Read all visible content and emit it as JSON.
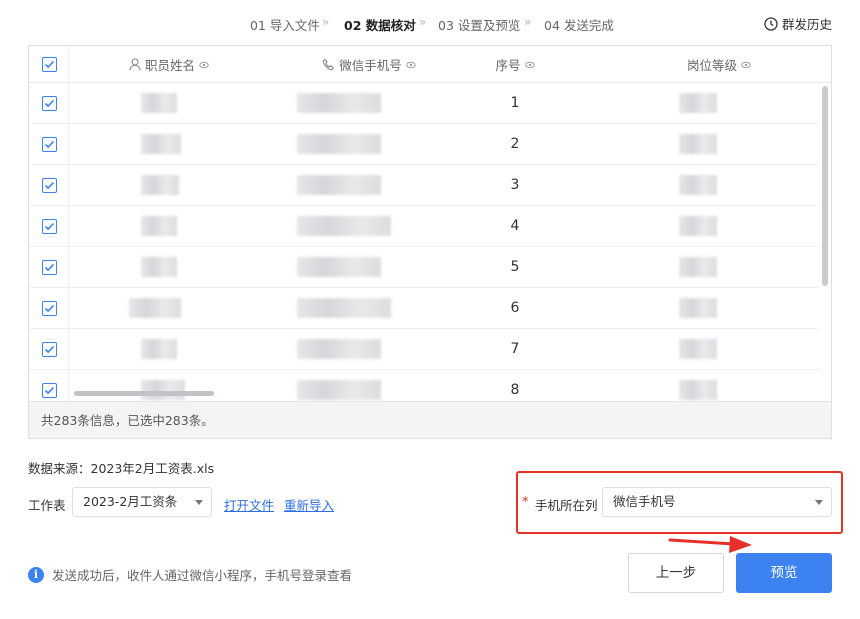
{
  "steps": [
    {
      "label": "01 导入文件",
      "active": false
    },
    {
      "label": "02 数据核对",
      "active": true
    },
    {
      "label": "03 设置及预览",
      "active": false
    },
    {
      "label": "04 发送完成",
      "active": false
    }
  ],
  "step_separator": "»",
  "history_label": "群发历史",
  "table": {
    "columns": [
      {
        "label": "职员姓名",
        "icon": "user-icon"
      },
      {
        "label": "微信手机号",
        "icon": "phone-icon"
      },
      {
        "label": "序号",
        "icon": null
      },
      {
        "label": "岗位等级",
        "icon": null
      }
    ],
    "rows": [
      {
        "seq": "1"
      },
      {
        "seq": "2"
      },
      {
        "seq": "3"
      },
      {
        "seq": "4"
      },
      {
        "seq": "5"
      },
      {
        "seq": "6"
      },
      {
        "seq": "7"
      },
      {
        "seq": "8"
      }
    ],
    "footer": "共283条信息，已选中283条。"
  },
  "source_text": "数据来源：2023年2月工资表.xls",
  "worksheet": {
    "label": "工作表",
    "value": "2023-2月工资条"
  },
  "links": {
    "open_file": "打开文件",
    "reimport": "重新导入"
  },
  "phone_column": {
    "required_mark": "*",
    "label": "手机所在列",
    "value": "微信手机号"
  },
  "info_text": "发送成功后，收件人通过微信小程序，手机号登录查看",
  "buttons": {
    "prev": "上一步",
    "next": "预览"
  },
  "colors": {
    "accent": "#3c82f0",
    "highlight": "#e8302b"
  }
}
